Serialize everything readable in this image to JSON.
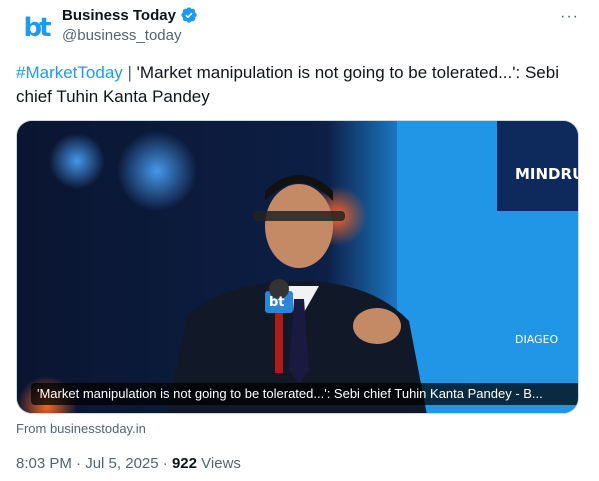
{
  "account": {
    "display_name": "Business Today",
    "handle": "@business_today",
    "avatar_text": "bt",
    "verified_color": "#1d9bf0"
  },
  "more_label": "···",
  "tweet": {
    "hashtag": "#MarketToday",
    "separator": "|",
    "text": "'Market manipulation is not going to be tolerated...': Sebi chief Tuhin Kanta Pandey"
  },
  "card": {
    "caption": "'Market manipulation is not going to be tolerated...': Sebi chief Tuhin Kanta Pandey  - B...",
    "mic_logo": "bt",
    "backdrop_text": "MINDRUS",
    "banner_text": "DIAGEO",
    "source": "From businesstoday.in"
  },
  "meta": {
    "time": "8:03 PM",
    "dot": "·",
    "date": "Jul 5, 2025",
    "views_count": "922",
    "views_label": "Views"
  },
  "colors": {
    "accent": "#1d9bf0",
    "muted": "#536471",
    "text": "#0f1419"
  }
}
